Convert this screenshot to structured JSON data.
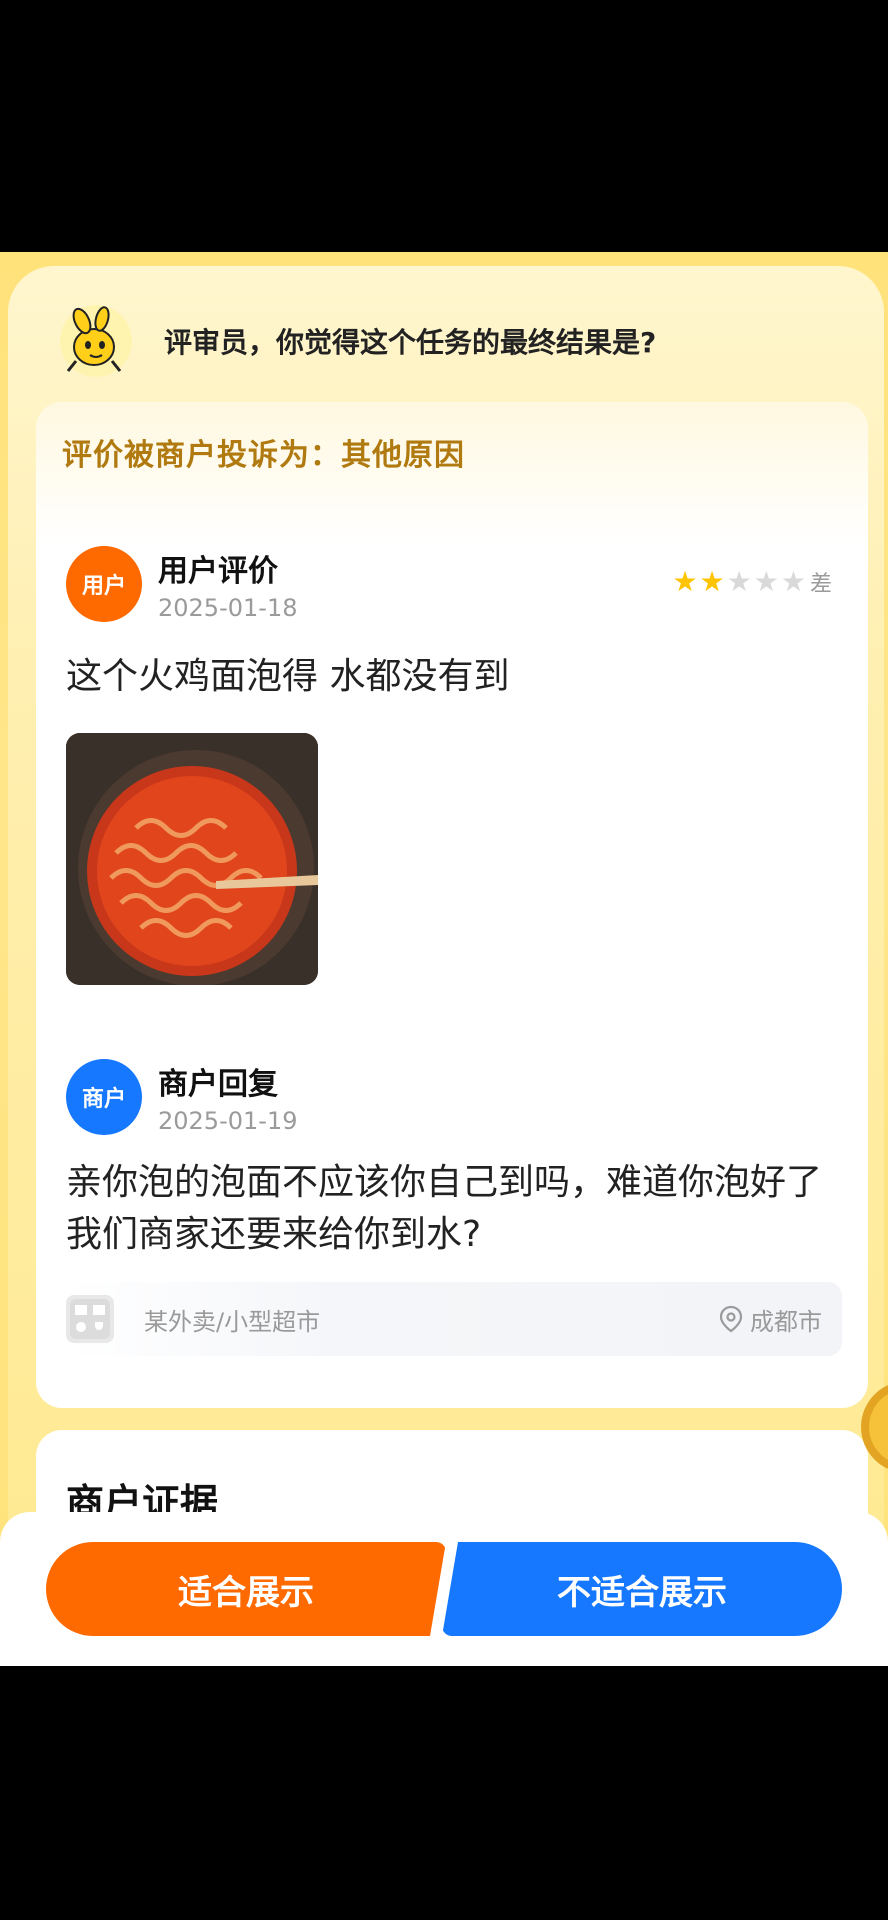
{
  "header": {
    "question": "评审员，你觉得这个任务的最终结果是?"
  },
  "complaint": {
    "text": "评价被商户投诉为：其他原因"
  },
  "user_review": {
    "avatar_label": "用户",
    "title": "用户评价",
    "date": "2025-01-18",
    "rating": 2,
    "rating_max": 5,
    "rating_label": "差",
    "text": "这个火鸡面泡得 水都没有到",
    "photo_icon": "instant-noodles-photo"
  },
  "merchant_reply": {
    "avatar_label": "商户",
    "title": "商户回复",
    "date": "2025-01-19",
    "text": "亲你泡的泡面不应该你自己到吗，难道你泡好了我们商家还要来给你到水?"
  },
  "shop": {
    "name": "某外卖/小型超市",
    "location": "成都市",
    "icon": "shop-icon"
  },
  "evidence": {
    "title": "商户证据"
  },
  "actions": {
    "suitable": "适合展示",
    "unsuitable": "不适合展示"
  },
  "colors": {
    "accent_orange": "#ff6a00",
    "accent_blue": "#1677ff",
    "star": "#ffc400",
    "complaint": "#b07a10"
  }
}
